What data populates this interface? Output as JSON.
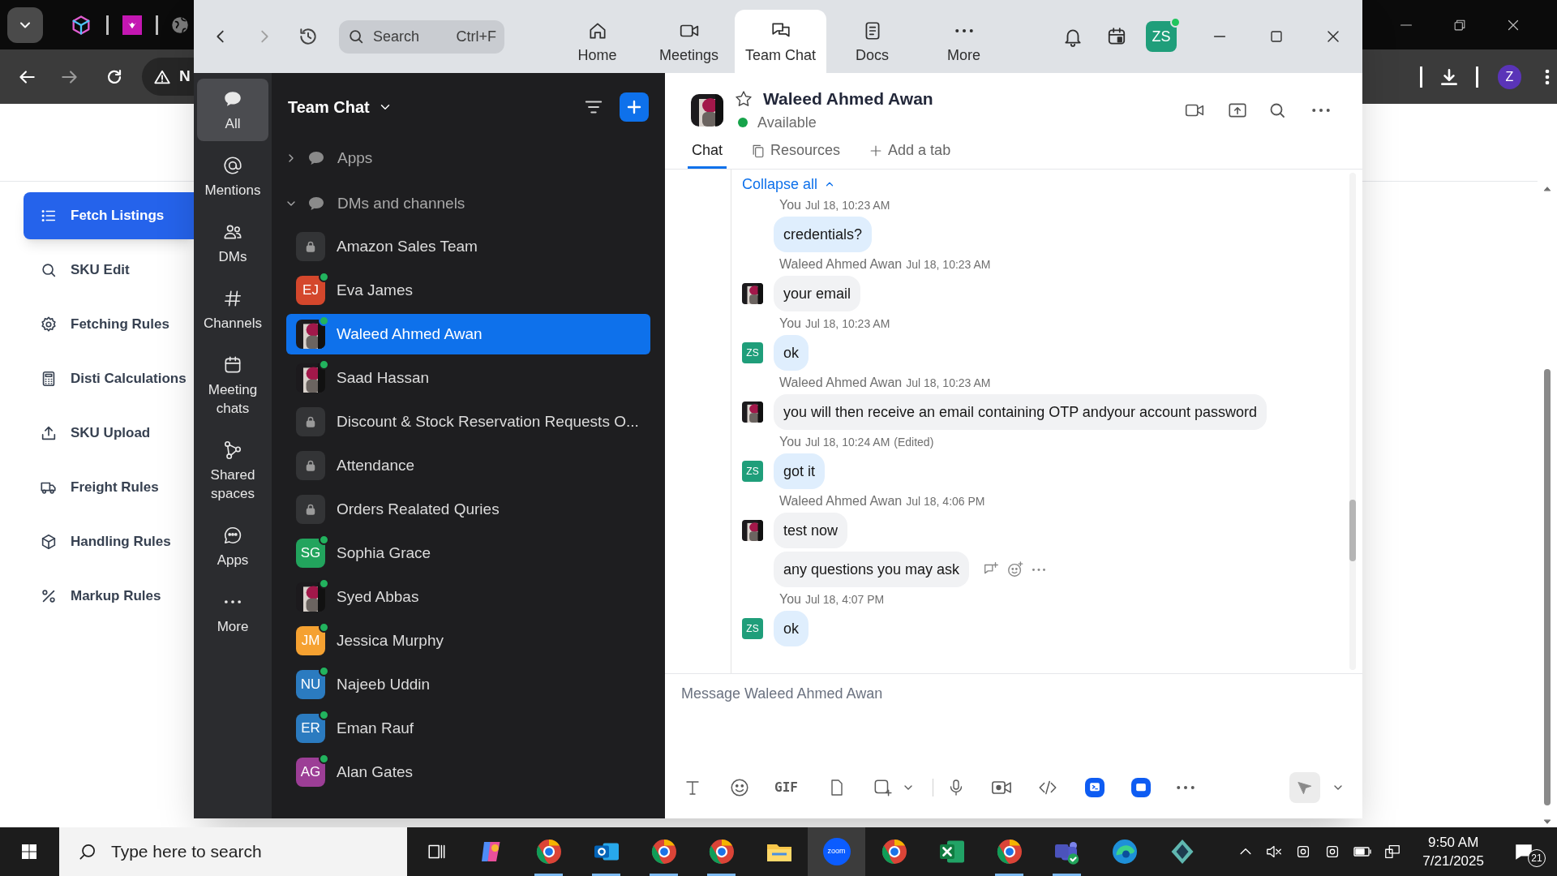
{
  "browser": {
    "address_text": "N",
    "profile_initial": "Z"
  },
  "web_sidebar": [
    {
      "label": "Fetch Listings",
      "selected": true
    },
    {
      "label": "SKU Edit",
      "selected": false
    },
    {
      "label": "Fetching Rules",
      "selected": false
    },
    {
      "label": "Disti Calculations",
      "selected": false
    },
    {
      "label": "SKU Upload",
      "selected": false
    },
    {
      "label": "Freight Rules",
      "selected": false
    },
    {
      "label": "Handling Rules",
      "selected": false
    },
    {
      "label": "Markup Rules",
      "selected": false
    }
  ],
  "zoom": {
    "search": {
      "placeholder": "Search",
      "shortcut": "Ctrl+F"
    },
    "tabs": [
      {
        "label": "Home",
        "selected": false
      },
      {
        "label": "Meetings",
        "selected": false
      },
      {
        "label": "Team Chat",
        "selected": true
      },
      {
        "label": "Docs",
        "selected": false
      },
      {
        "label": "More",
        "selected": false
      }
    ],
    "profile": {
      "initials": "ZS",
      "online": true
    },
    "rail": [
      {
        "label": "All",
        "selected": true
      },
      {
        "label": "Mentions",
        "selected": false
      },
      {
        "label": "DMs",
        "selected": false
      },
      {
        "label": "Channels",
        "selected": false
      },
      {
        "label": "Meeting chats",
        "selected": false
      },
      {
        "label": "Shared spaces",
        "selected": false
      },
      {
        "label": "Apps",
        "selected": false
      },
      {
        "label": "More",
        "selected": false
      }
    ],
    "chat_list": {
      "title": "Team Chat",
      "sections": [
        {
          "label": "Apps",
          "expanded": false
        },
        {
          "label": "DMs and channels",
          "expanded": true,
          "children": [
            {
              "kind": "channel",
              "name": "Amazon Sales Team",
              "online": false,
              "selected": false
            },
            {
              "kind": "initials",
              "name": "Eva James",
              "initials": "EJ",
              "color": "#d4472c",
              "online": true,
              "selected": false
            },
            {
              "name": "Waleed Ahmed Awan",
              "online": true,
              "selected": true
            },
            {
              "name": "Saad Hassan",
              "online": true,
              "selected": false
            },
            {
              "kind": "channel",
              "name": "Discount & Stock Reservation Requests O...",
              "online": false,
              "selected": false
            },
            {
              "kind": "channel",
              "name": "Attendance",
              "online": false,
              "selected": false
            },
            {
              "kind": "channel",
              "name": "Orders Realated Quries",
              "online": false,
              "selected": false
            },
            {
              "kind": "initials",
              "name": "Sophia Grace",
              "initials": "SG",
              "color": "#22a45d",
              "online": true,
              "selected": false
            },
            {
              "name": "Syed Abbas",
              "online": true,
              "selected": false
            },
            {
              "kind": "initials",
              "name": "Jessica Murphy",
              "initials": "JM",
              "color": "#f5a131",
              "online": true,
              "selected": false
            },
            {
              "kind": "initials",
              "name": "Najeeb Uddin",
              "initials": "NU",
              "color": "#2b7bc0",
              "online": true,
              "selected": false
            },
            {
              "kind": "initials",
              "name": "Eman Rauf",
              "initials": "ER",
              "color": "#2b7bc0",
              "online": true,
              "selected": false
            },
            {
              "kind": "initials",
              "name": "Alan Gates",
              "initials": "AG",
              "color": "#9c3e96",
              "online": true,
              "selected": false
            }
          ]
        }
      ]
    },
    "conversation": {
      "name": "Waleed Ahmed Awan",
      "status": "Available",
      "tabs": [
        {
          "label": "Chat",
          "selected": true
        },
        {
          "label": "Resources",
          "selected": false
        },
        {
          "label": "Add a tab",
          "selected": false
        }
      ],
      "collapse_label": "Collapse all",
      "messages": [
        {
          "kind": "self",
          "sender": "You",
          "time": "Jul 18, 10:23 AM",
          "bubbles": [
            "credentials?"
          ]
        },
        {
          "kind": "other",
          "sender": "Waleed Ahmed Awan",
          "time": "Jul 18, 10:23 AM",
          "bubbles": [
            "your email"
          ]
        },
        {
          "kind": "self",
          "sender": "You",
          "initials": "ZS",
          "time": "Jul 18, 10:23 AM",
          "bubbles": [
            "ok"
          ]
        },
        {
          "kind": "other",
          "sender": "Waleed Ahmed Awan",
          "time": "Jul 18, 10:23 AM",
          "bubbles": [
            "you will then receive an email containing OTP andyour account password"
          ]
        },
        {
          "kind": "self",
          "sender": "You",
          "initials": "ZS",
          "time": "Jul 18, 10:24 AM",
          "edited_label": "(Edited)",
          "bubbles": [
            "got it"
          ]
        },
        {
          "kind": "other",
          "sender": "Waleed Ahmed Awan",
          "time": "Jul 18, 4:06 PM",
          "bubbles": [
            "test now",
            "any questions you may ask"
          ]
        },
        {
          "kind": "self",
          "sender": "You",
          "initials": "ZS",
          "time": "Jul 18, 4:07 PM",
          "bubbles": [
            "ok"
          ]
        }
      ],
      "composer": {
        "placeholder": "Message Waleed Ahmed Awan",
        "gif_label": "GIF"
      }
    }
  },
  "taskbar": {
    "search_placeholder": "Type here to search",
    "zoom_label": "zoom",
    "time": "9:50 AM",
    "date": "7/21/2025",
    "notifications": "21"
  }
}
